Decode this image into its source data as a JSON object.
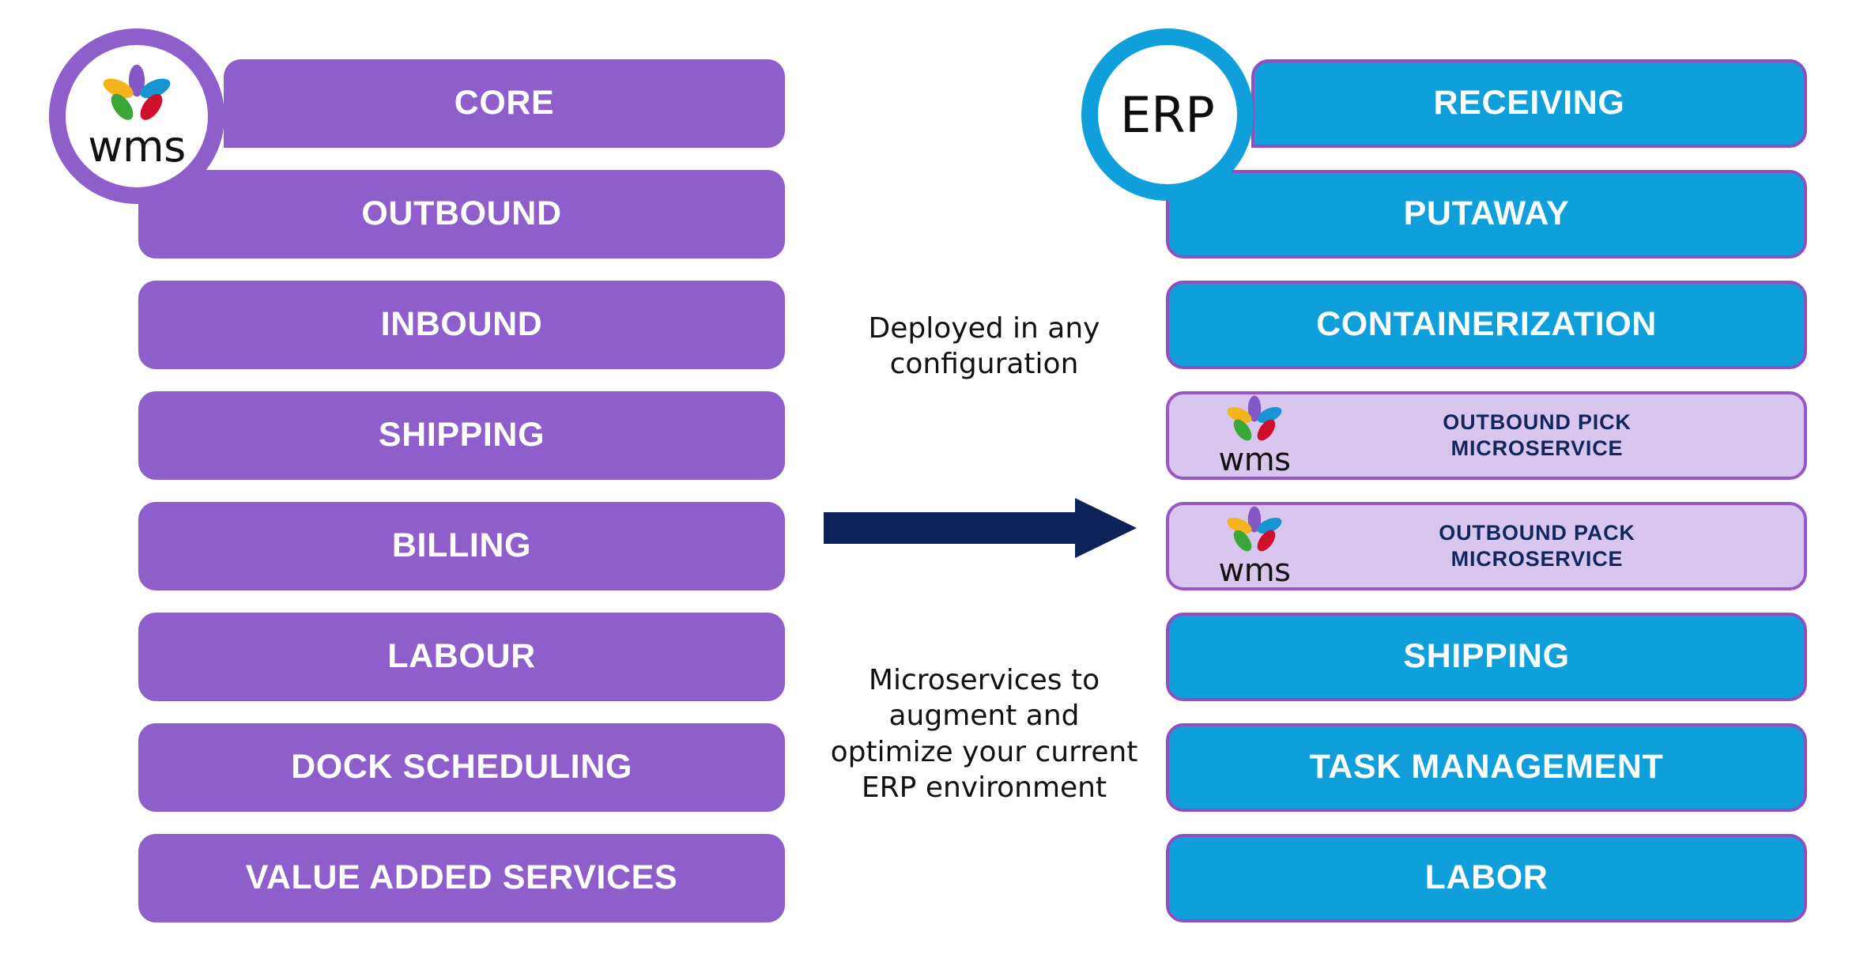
{
  "diagram": {
    "left_badge": {
      "name": "wms",
      "wordmark": "wms",
      "color": "#8e5fcb"
    },
    "right_badge": {
      "name": "ERP",
      "label": "ERP",
      "color": "#0f9fdb"
    },
    "left_column": {
      "accent": "#8e5fcb",
      "items": [
        {
          "label": "CORE"
        },
        {
          "label": "OUTBOUND"
        },
        {
          "label": "INBOUND"
        },
        {
          "label": "SHIPPING"
        },
        {
          "label": "BILLING"
        },
        {
          "label": "LABOUR"
        },
        {
          "label": "DOCK SCHEDULING"
        },
        {
          "label": "VALUE ADDED SERVICES"
        }
      ]
    },
    "right_column": {
      "accent": "#0f9fdb",
      "border": "#8e4fc0",
      "microservice_fill": "#d9c6ef",
      "microservice_text": "#11265c",
      "items": [
        {
          "label": "RECEIVING",
          "kind": "erp"
        },
        {
          "label": "PUTAWAY",
          "kind": "erp"
        },
        {
          "label": "CONTAINERIZATION",
          "kind": "erp"
        },
        {
          "label": "OUTBOUND PICK\nMICROSERVICE",
          "kind": "microservice",
          "logo": "wms"
        },
        {
          "label": "OUTBOUND PACK\nMICROSERVICE",
          "kind": "microservice",
          "logo": "wms"
        },
        {
          "label": "SHIPPING",
          "kind": "erp"
        },
        {
          "label": "TASK MANAGEMENT",
          "kind": "erp"
        },
        {
          "label": "LABOR",
          "kind": "erp"
        }
      ]
    },
    "center": {
      "note_top": "Deployed in any\nconfiguration",
      "note_bottom": "Microservices to\naugment and\noptimize your current\nERP environment",
      "arrow_color": "#0d2259"
    }
  }
}
